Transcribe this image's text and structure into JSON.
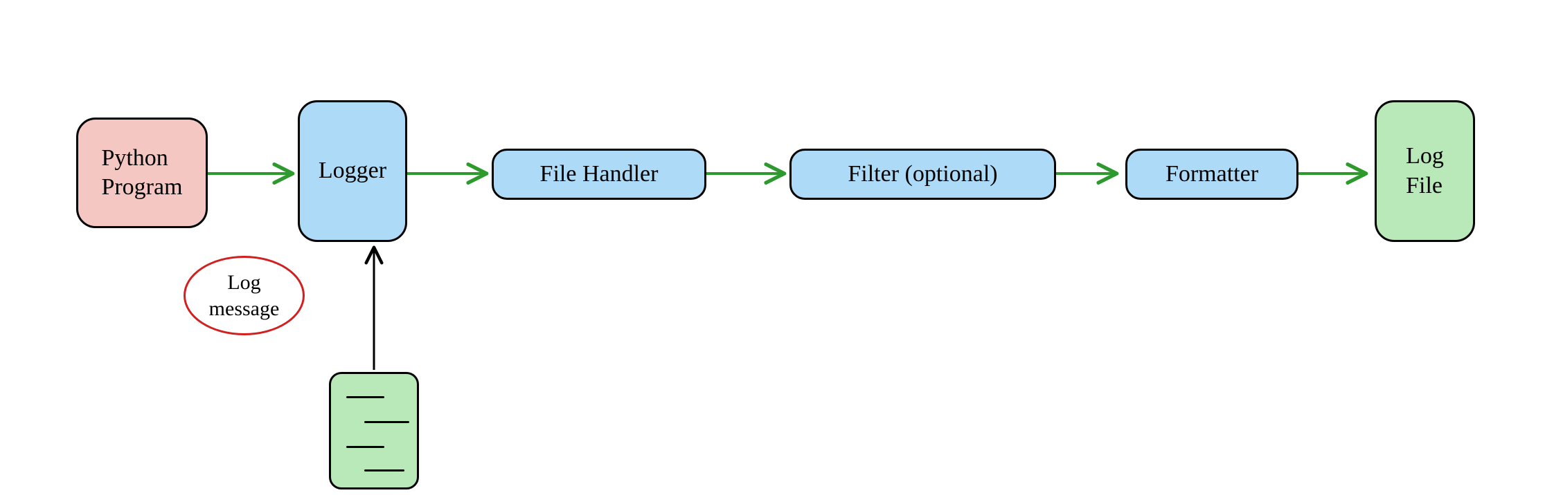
{
  "diagram": {
    "nodes": {
      "python_program": "Python\nProgram",
      "logger": "Logger",
      "file_handler": "File Handler",
      "filter": "Filter (optional)",
      "formatter": "Formatter",
      "log_file": "Log\nFile"
    },
    "log_message": "Log\nmessage",
    "colors": {
      "arrow_green": "#2e9a2e",
      "arrow_black": "#000000",
      "pink": "#f4c7c3",
      "blue": "#addbf7",
      "green": "#b9e8b9",
      "ellipse_border": "#d21f1f"
    }
  }
}
